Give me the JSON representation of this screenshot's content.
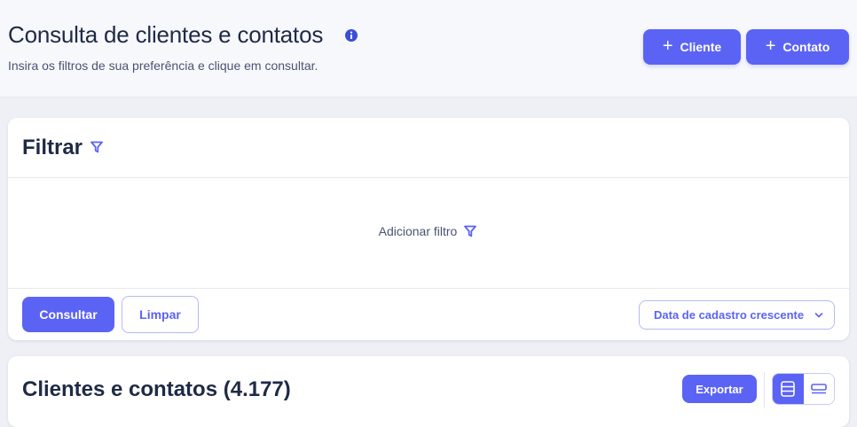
{
  "header": {
    "title": "Consulta de clientes e contatos",
    "subtitle": "Insira os filtros de sua preferência e clique em consultar.",
    "buttons": {
      "cliente_label": "Cliente",
      "contato_label": "Contato"
    }
  },
  "filter": {
    "title": "Filtrar",
    "add_filter_label": "Adicionar filtro",
    "consultar_label": "Consultar",
    "limpar_label": "Limpar",
    "sort_selected": "Data de cadastro crescente"
  },
  "results": {
    "title": "Clientes e contatos (4.177)",
    "exportar_label": "Exportar",
    "view_mode": "cards"
  },
  "colors": {
    "accent": "#5b63f5",
    "text": "#1f2a44",
    "muted": "#4a5470"
  },
  "icons": {
    "info": "info-icon",
    "filter": "filter-icon",
    "plus": "plus-icon",
    "chevron": "chevron-down-icon",
    "cards_view": "card-view-icon",
    "list_view": "list-view-icon"
  }
}
